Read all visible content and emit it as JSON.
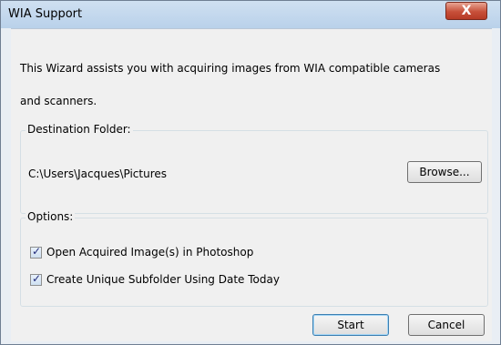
{
  "window": {
    "title": "WIA Support",
    "close_label": "X"
  },
  "intro": {
    "line1": "This Wizard assists you with acquiring images from WIA compatible cameras",
    "line2": "and scanners."
  },
  "destination": {
    "label": "Destination Folder:",
    "path": "C:\\Users\\Jacques\\Pictures",
    "browse_label": "Browse..."
  },
  "options": {
    "label": "Options:",
    "items": [
      {
        "label": "Open Acquired Image(s) in Photoshop",
        "checked": true
      },
      {
        "label": "Create Unique Subfolder Using Date Today",
        "checked": true
      }
    ]
  },
  "actions": {
    "start_label": "Start",
    "cancel_label": "Cancel"
  }
}
